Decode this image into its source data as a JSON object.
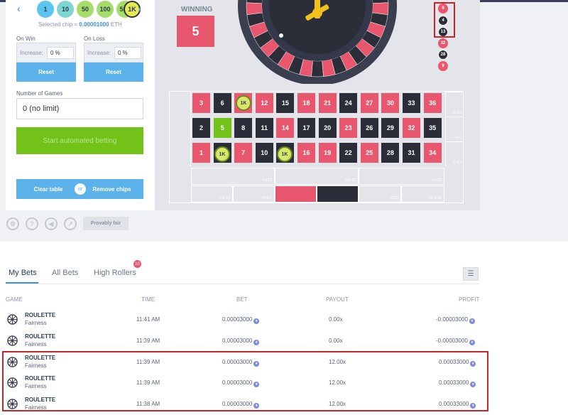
{
  "chips": {
    "values": [
      "1",
      "10",
      "50",
      "100",
      "500",
      "1K"
    ],
    "selected_label": "Selected chip = ",
    "selected_value": "0.00001000",
    "selected_unit": " ETH"
  },
  "controls": {
    "on_win_label": "On Win",
    "on_loss_label": "On Loss",
    "increase_label": "Increase:",
    "win_value": "0 %",
    "loss_value": "0 %",
    "reset_label": "Reset",
    "number_of_games_label": "Number of Games",
    "number_of_games_value": "0 (no limit)",
    "start_button": "Start automated betting",
    "clear_table": "Clear table",
    "or": "or",
    "remove_chips": "Remove chips",
    "provably_fair": "Provably fair"
  },
  "winning": {
    "label": "WINNING",
    "number": "5"
  },
  "history": [
    {
      "n": "9",
      "color": "red"
    },
    {
      "n": "4",
      "color": "black"
    },
    {
      "n": "13",
      "color": "black"
    },
    {
      "n": "32",
      "color": "red"
    },
    {
      "n": "28",
      "color": "black"
    },
    {
      "n": "9",
      "color": "red"
    }
  ],
  "board": {
    "rows": [
      [
        {
          "n": "3",
          "c": "red"
        },
        {
          "n": "6",
          "c": "black"
        },
        {
          "n": "9",
          "c": "red"
        },
        {
          "n": "12",
          "c": "red"
        },
        {
          "n": "15",
          "c": "black"
        },
        {
          "n": "18",
          "c": "red"
        },
        {
          "n": "21",
          "c": "red"
        },
        {
          "n": "24",
          "c": "black"
        },
        {
          "n": "27",
          "c": "red"
        },
        {
          "n": "30",
          "c": "red"
        },
        {
          "n": "33",
          "c": "black"
        },
        {
          "n": "36",
          "c": "red"
        }
      ],
      [
        {
          "n": "2",
          "c": "black"
        },
        {
          "n": "5",
          "c": "green"
        },
        {
          "n": "8",
          "c": "black"
        },
        {
          "n": "11",
          "c": "black"
        },
        {
          "n": "14",
          "c": "red"
        },
        {
          "n": "17",
          "c": "black"
        },
        {
          "n": "20",
          "c": "black"
        },
        {
          "n": "23",
          "c": "red"
        },
        {
          "n": "26",
          "c": "black"
        },
        {
          "n": "29",
          "c": "black"
        },
        {
          "n": "32",
          "c": "red"
        },
        {
          "n": "35",
          "c": "black"
        }
      ],
      [
        {
          "n": "1",
          "c": "red"
        },
        {
          "n": "4",
          "c": "black"
        },
        {
          "n": "7",
          "c": "red"
        },
        {
          "n": "10",
          "c": "black"
        },
        {
          "n": "13",
          "c": "black"
        },
        {
          "n": "16",
          "c": "red"
        },
        {
          "n": "19",
          "c": "red"
        },
        {
          "n": "22",
          "c": "black"
        },
        {
          "n": "25",
          "c": "red"
        },
        {
          "n": "28",
          "c": "black"
        },
        {
          "n": "31",
          "c": "black"
        },
        {
          "n": "34",
          "c": "red"
        }
      ]
    ],
    "column_labels": [
      "2 to 1",
      "2 to 1",
      "2 to 1"
    ],
    "dozens": [
      "1st 12",
      "2nd 12",
      "3rd 12"
    ],
    "even_money": [
      "1 to 18",
      "EVEN",
      "",
      "",
      "ODD",
      "19 to 36"
    ],
    "placed_chips": [
      "1K",
      "1K",
      "1K"
    ]
  },
  "bets": {
    "tabs": [
      "My Bets",
      "All Bets",
      "High Rollers"
    ],
    "high_rollers_badge": "10",
    "headers": [
      "GAME",
      "TIME",
      "BET",
      "PAYOUT",
      "PROFIT"
    ],
    "rows": [
      {
        "game": "ROULETTE",
        "sub": "Fairness",
        "time": "11:41 AM",
        "bet": "0.00003000",
        "payout": "0.00x",
        "profit": "-0.00003000",
        "positive": false
      },
      {
        "game": "ROULETTE",
        "sub": "Fairness",
        "time": "11:39 AM",
        "bet": "0.00003000",
        "payout": "0.00x",
        "profit": "-0.00003000",
        "positive": false
      },
      {
        "game": "ROULETTE",
        "sub": "Fairness",
        "time": "11:39 AM",
        "bet": "0.00003000",
        "payout": "12.00x",
        "profit": "0.00033000",
        "positive": true
      },
      {
        "game": "ROULETTE",
        "sub": "Fairness",
        "time": "11:39 AM",
        "bet": "0.00003000",
        "payout": "12.00x",
        "profit": "0.00033000",
        "positive": true
      },
      {
        "game": "ROULETTE",
        "sub": "Fairness",
        "time": "11:38 AM",
        "bet": "0.00003000",
        "payout": "12.00x",
        "profit": "0.00033000",
        "positive": true
      }
    ]
  },
  "colors": {
    "red": "#e9576f",
    "black": "#2b2e38",
    "green": "#72c21a",
    "accent": "#5cb3ec"
  }
}
